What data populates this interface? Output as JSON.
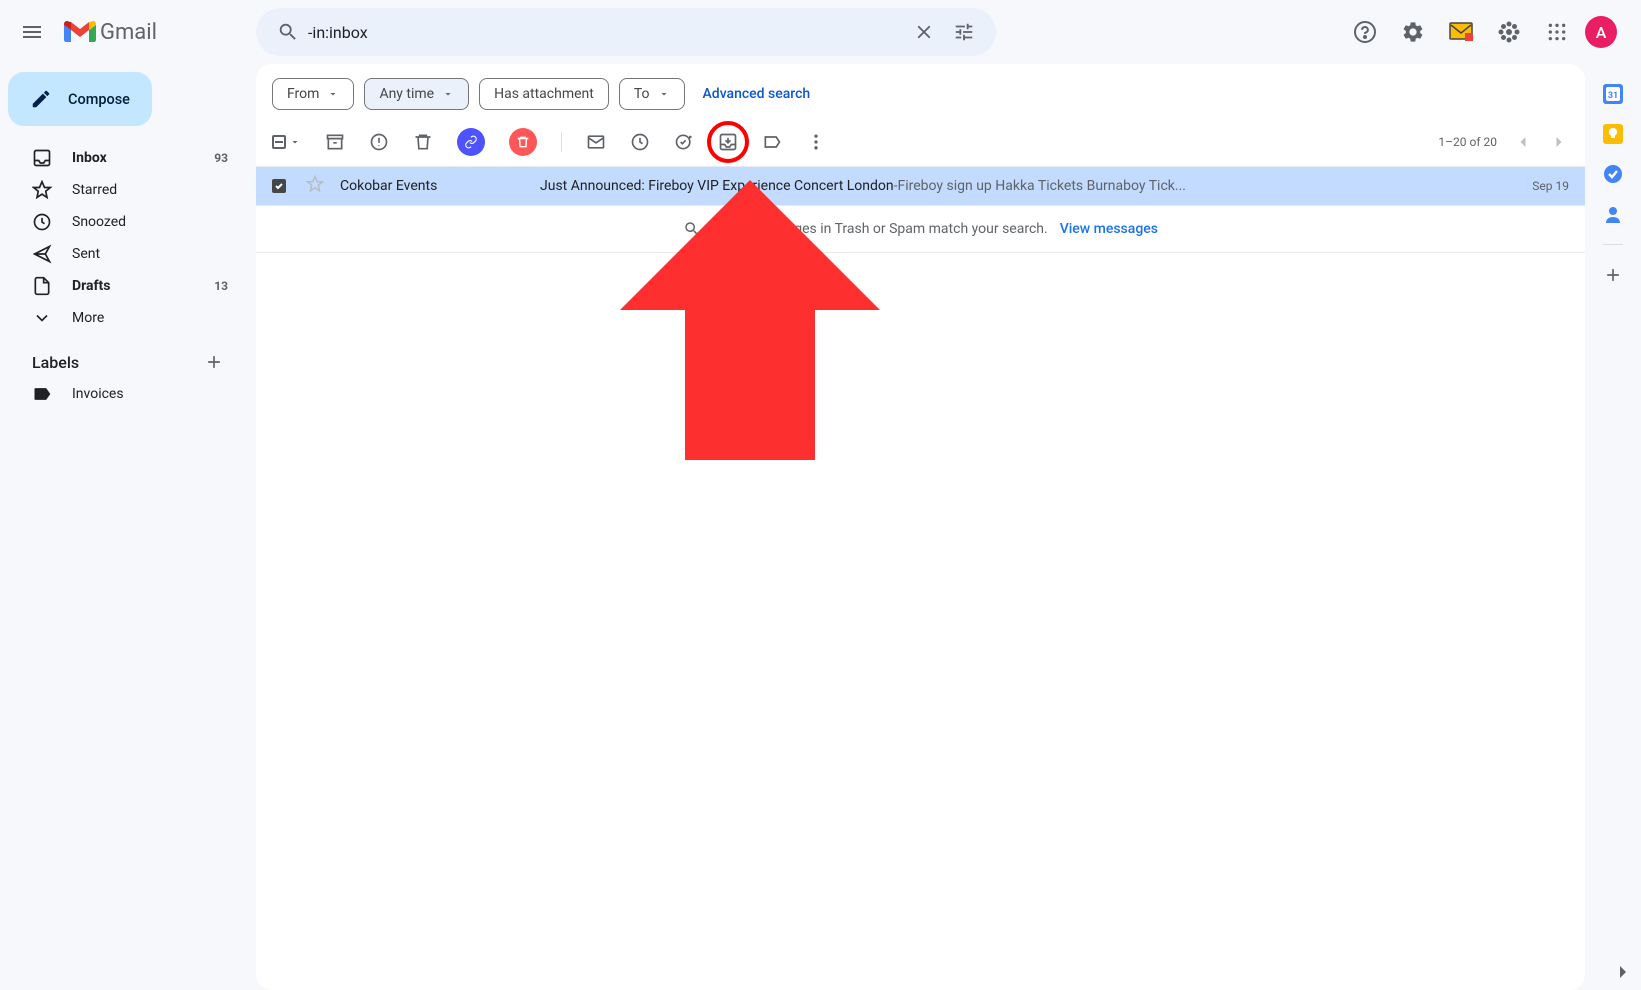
{
  "header": {
    "app_name": "Gmail",
    "search_value": "-in:inbox",
    "avatar_letter": "A"
  },
  "sidebar": {
    "compose_label": "Compose",
    "items": [
      {
        "label": "Inbox",
        "count": "93",
        "bold": true
      },
      {
        "label": "Starred",
        "count": ""
      },
      {
        "label": "Snoozed",
        "count": ""
      },
      {
        "label": "Sent",
        "count": ""
      },
      {
        "label": "Drafts",
        "count": "13",
        "bold": true
      },
      {
        "label": "More",
        "count": ""
      }
    ],
    "labels_header": "Labels",
    "labels": [
      {
        "label": "Invoices"
      }
    ]
  },
  "filters": {
    "from": "From",
    "any_time": "Any time",
    "has_attachment": "Has attachment",
    "to": "To",
    "advanced": "Advanced search"
  },
  "pagination": {
    "text": "1–20 of 20"
  },
  "email": {
    "sender": "Cokobar Events",
    "subject": "Just Announced: Fireboy VIP Experience Concert London",
    "separator": " - ",
    "snippet": "Fireboy sign up Hakka Tickets Burnaboy Tick...",
    "date": "Sep 19"
  },
  "banner": {
    "text": "Some messages in Trash or Spam match your search.",
    "link": "View messages"
  }
}
